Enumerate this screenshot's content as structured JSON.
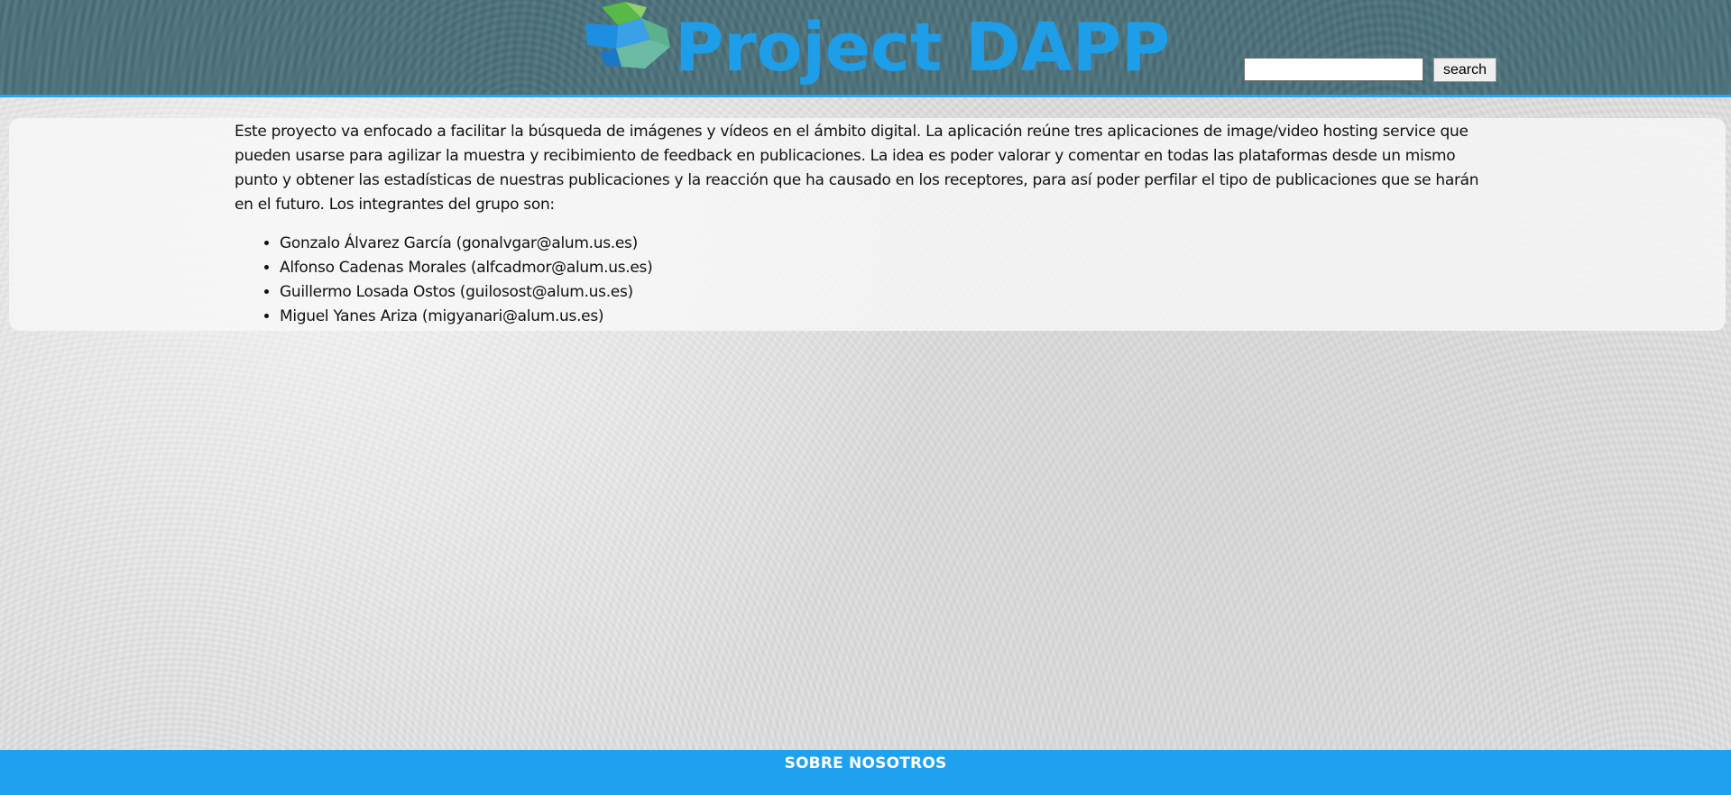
{
  "header": {
    "title": "Project DAPP",
    "search": {
      "value": "",
      "placeholder": "",
      "button_label": "search"
    }
  },
  "main": {
    "description": "Este proyecto va enfocado a facilitar la búsqueda de imágenes y vídeos en el ámbito digital. La aplicación reúne tres aplicaciones de image/video hosting service que pueden usarse para agilizar la muestra y recibimiento de feedback en publicaciones. La idea es poder valorar y comentar en todas las plataformas desde un mismo punto y obtener las estadísticas de nuestras publicaciones y la reacción que ha causado en los receptores, para así poder perfilar el tipo de publicaciones que se harán en el futuro. Los integrantes del grupo son:",
    "members": [
      "Gonzalo Álvarez García (gonalvgar@alum.us.es)",
      "Alfonso Cadenas Morales (alfcadmor@alum.us.es)",
      "Guillermo Losada Ostos (guilosost@alum.us.es)",
      "Miguel Yanes Ariza (migyanari@alum.us.es)"
    ]
  },
  "footer": {
    "link_label": "SOBRE NOSOTROS"
  },
  "colors": {
    "header_bg": "#49707a",
    "accent": "#1e9ee8",
    "footer_bg": "#1ea2ef"
  },
  "icons": {
    "logo": "cube-logo-icon"
  }
}
